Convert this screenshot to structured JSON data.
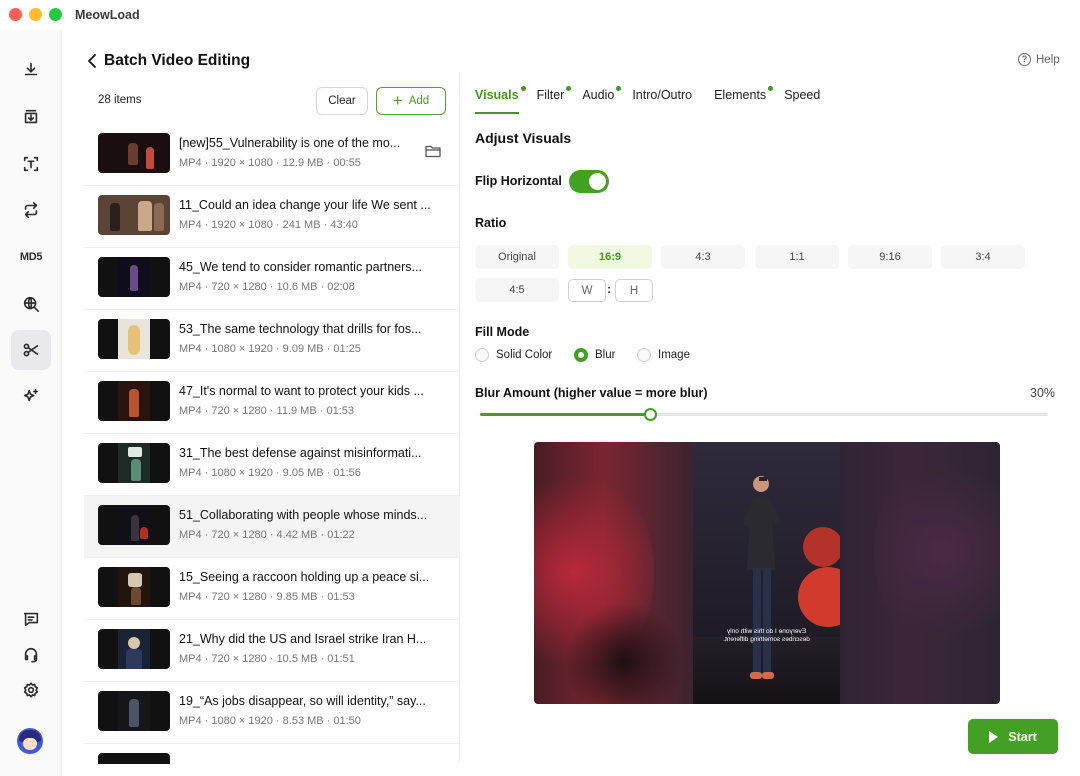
{
  "window": {
    "app_title": "MeowLoad"
  },
  "rail": {
    "items": [
      {
        "icon": "download-icon"
      },
      {
        "icon": "batch-download-icon"
      },
      {
        "icon": "text-extract-icon"
      },
      {
        "icon": "convert-icon"
      },
      {
        "label": "MD5"
      },
      {
        "icon": "web-search-icon"
      },
      {
        "icon": "scissors-icon",
        "active": true
      },
      {
        "icon": "ai-sparkle-icon"
      }
    ],
    "bottom": [
      {
        "icon": "feedback-icon"
      },
      {
        "icon": "support-icon"
      },
      {
        "icon": "settings-icon"
      }
    ]
  },
  "header": {
    "title": "Batch Video Editing",
    "help_label": "Help"
  },
  "list": {
    "count": "28 items",
    "clear_label": "Clear",
    "add_label": "Add",
    "items": [
      {
        "name": "[new]55_Vulnerability is one of the mo...",
        "meta": "MP4 · 1920 × 1080 · 12.9 MB · 00:55"
      },
      {
        "name": "11_Could an idea change your life We sent ...",
        "meta": "MP4 · 1920 × 1080 · 241 MB · 43:40"
      },
      {
        "name": "45_We tend to consider romantic partners...",
        "meta": "MP4 · 720 × 1280 · 10.6 MB · 02:08"
      },
      {
        "name": "53_The same technology that drills for fos...",
        "meta": "MP4 · 1080 × 1920 · 9.09 MB · 01:25"
      },
      {
        "name": "47_It's normal to want to protect your kids ...",
        "meta": "MP4 · 720 × 1280 · 11.9 MB · 01:53"
      },
      {
        "name": "31_The best defense against misinformati...",
        "meta": "MP4 · 1080 × 1920 · 9.05 MB · 01:56"
      },
      {
        "name": "51_Collaborating with people whose minds...",
        "meta": "MP4 · 720 × 1280 · 4.42 MB · 01:22"
      },
      {
        "name": "15_Seeing a raccoon holding up a peace si...",
        "meta": "MP4 · 720 × 1280 · 9.85 MB · 01:53"
      },
      {
        "name": "21_Why did the US and Israel strike Iran H...",
        "meta": "MP4 · 720 × 1280 · 10.5 MB · 01:51"
      },
      {
        "name": "19_“As jobs disappear, so will identity,” say...",
        "meta": "MP4 · 1080 × 1920 · 8.53 MB · 01:50"
      }
    ]
  },
  "tabs": [
    {
      "label": "Visuals",
      "active": true,
      "dot": true
    },
    {
      "label": "Filter",
      "dot": true
    },
    {
      "label": "Audio",
      "dot": true
    },
    {
      "label": "Intro/Outro",
      "dot": false
    },
    {
      "label": "Elements",
      "dot": true
    },
    {
      "label": "Speed",
      "dot": false
    }
  ],
  "visuals": {
    "section_title": "Adjust Visuals",
    "flip_label": "Flip Horizontal",
    "flip_on": true,
    "ratio_title": "Ratio",
    "ratios": [
      "Original",
      "16:9",
      "4:3",
      "1:1",
      "9:16",
      "3:4",
      "4:5"
    ],
    "ratio_selected": "16:9",
    "width_placeholder": "W",
    "height_placeholder": "H",
    "colon": ":",
    "fill_title": "Fill Mode",
    "fill_options": [
      "Solid Color",
      "Blur",
      "Image"
    ],
    "fill_selected": "Blur",
    "blur_title": "Blur Amount (higher value = more blur)",
    "blur_value": "30%",
    "blur_fraction": 0.3,
    "subtitle": "Everyone I do this with only describes something different."
  },
  "start_label": "Start",
  "colors": {
    "accent": "#43a022",
    "accent_text": "#3f9a1f"
  }
}
